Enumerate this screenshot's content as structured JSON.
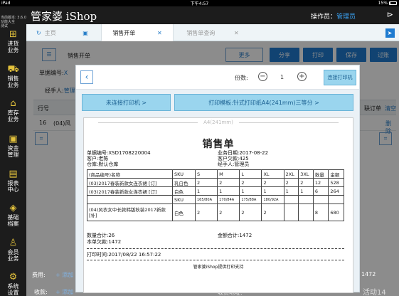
{
  "status": {
    "device": "iPad",
    "time": "下午4:57",
    "center": "已授权给测试",
    "battery": "15%"
  },
  "sidebar": {
    "version_lines": [
      "当前版本: 3.6.0",
      "功能大全",
      "测试"
    ],
    "items": [
      {
        "label1": "进货",
        "label2": "业务",
        "icon": "cart-down-icon"
      },
      {
        "label1": "销售",
        "label2": "业务",
        "icon": "cart-icon"
      },
      {
        "label1": "库存",
        "label2": "业务",
        "icon": "warehouse-icon"
      },
      {
        "label1": "资金",
        "label2": "管理",
        "icon": "money-icon"
      },
      {
        "label1": "报表",
        "label2": "中心",
        "icon": "report-icon"
      },
      {
        "label1": "基础",
        "label2": "档案",
        "icon": "layers-icon"
      },
      {
        "label1": "会员",
        "label2": "业务",
        "icon": "member-icon"
      },
      {
        "label1": "系统",
        "label2": "设置",
        "icon": "gear-icon"
      }
    ]
  },
  "topbar": {
    "brand_cn": "管家婆",
    "brand_en": "iShop",
    "operator_label": "操作员：",
    "operator_value": "管理员"
  },
  "tabs": [
    {
      "label": "主页"
    },
    {
      "label": "销售开单"
    },
    {
      "label": "销售单查询"
    }
  ],
  "page": {
    "title": "销售开单",
    "bill_no_label": "单据编号:",
    "bill_no_val": "X",
    "handler_label": "经手人:",
    "handler_val": "管理",
    "more": "更多",
    "share": "分享",
    "print": "打印",
    "save": "保存",
    "audit": "过账",
    "row_no": "行号",
    "row_no_val": "16",
    "row_product": "(04)风",
    "right_col": "联订单",
    "clear": "清空",
    "delete": "删除",
    "fee_label": "费用:",
    "fee_add": "+ 添加",
    "fee_total": "1472",
    "collect_label": "收款:",
    "add_short": "+ 添加",
    "collect_addr": "收货地址:",
    "watermark": "活动14"
  },
  "modal": {
    "copies_label": "份数:",
    "copies": "1",
    "connect_btn": "连接打印机",
    "printer_status": "未连接打印机 >",
    "template": "打印模板:针式打印纸A4(241mm)三等分 >",
    "paper": {
      "header": "A4(241mm)",
      "title": "销售单",
      "bill_no": "单据编号:XSD1708220004",
      "customer": "客户:老陈",
      "warehouse": "仓库:默认仓库",
      "date": "业务日期:2017-08-22",
      "owe": "客户欠款:425",
      "handler": "经手人:管理员",
      "columns": [
        "(商品编号)名称",
        "SKU",
        "S",
        "M",
        "L",
        "XL",
        "2XL",
        "3XL",
        "数量",
        "金额"
      ],
      "rows": [
        [
          "(03)2017春装新款女连衣裙 [订]",
          "乳白色",
          "2",
          "2",
          "2",
          "2",
          "2",
          "2",
          "12",
          "528"
        ],
        [
          "(03)2017春装新款女连衣裙 [订]",
          "白色",
          "1",
          "1",
          "1",
          "1",
          "1",
          "1",
          "6",
          "264"
        ],
        [
          "",
          "SKU",
          "165/80A",
          "170/84A",
          "175/88A",
          "180/92A",
          "",
          "",
          "",
          ""
        ],
        [
          "(04)风衣女中长款韩版秋装2017新款 [补]",
          "白色",
          "2",
          "2",
          "2",
          "2",
          "",
          "",
          "8",
          "680"
        ]
      ],
      "qty_total": "数量合计:26",
      "amount_total": "金额合计:1472",
      "owe_bill": "本单欠款:1472",
      "print_time": "打印时间:2017/08/22 16:57:22",
      "footer": "管家婆iShop提供打印支持"
    }
  },
  "colors": {
    "accent": "#1f7bd0",
    "sidebar_icon": "#e3c23c"
  }
}
